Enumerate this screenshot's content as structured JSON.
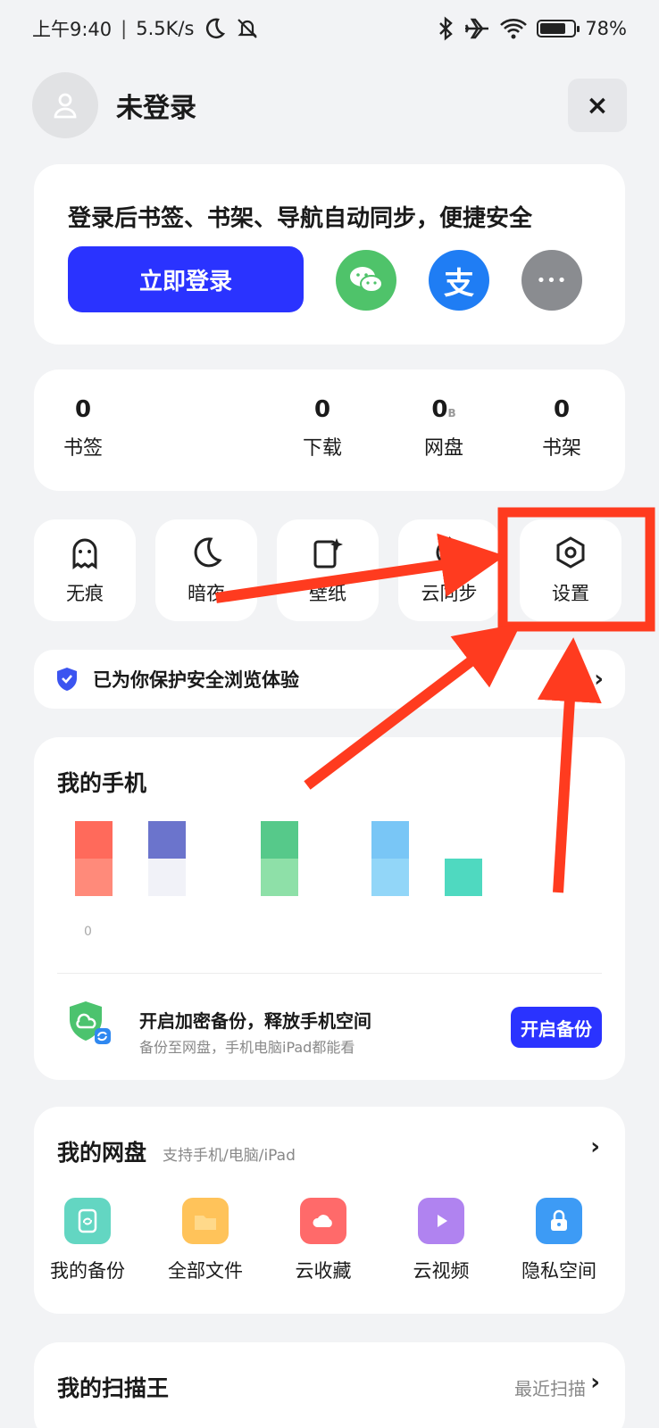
{
  "status_bar": {
    "time": "上午9:40",
    "net_speed": "5.5K/s",
    "battery": "78%",
    "battery_level": 0.78,
    "icons": [
      "moon-icon",
      "mute-icon",
      "bluetooth-icon",
      "airplane-icon",
      "wifi-icon",
      "battery-icon"
    ]
  },
  "header": {
    "user_name": "未登录",
    "close_label": "×"
  },
  "login": {
    "hint": "登录后书签、书架、导航自动同步，便捷安全",
    "button": "立即登录",
    "providers": [
      "wechat-icon",
      "alipay-icon",
      "more-icon"
    ],
    "more_glyph": "•••",
    "alipay_glyph": "支"
  },
  "stats": [
    {
      "value": "0",
      "unit": "",
      "label": "书签"
    },
    {
      "value": "0",
      "unit": "",
      "label": "下载"
    },
    {
      "value": "0",
      "unit": "B",
      "label": "网盘"
    },
    {
      "value": "0",
      "unit": "",
      "label": "书架"
    }
  ],
  "quick_tiles": [
    {
      "label": "无痕",
      "icon": "ghost-icon"
    },
    {
      "label": "暗夜",
      "icon": "moon-icon"
    },
    {
      "label": "壁纸",
      "icon": "wallpaper-icon"
    },
    {
      "label": "云同步",
      "icon": "sync-icon"
    },
    {
      "label": "设置",
      "icon": "gear-icon"
    }
  ],
  "security": {
    "text": "已为你保护安全浏览体验",
    "chevron": "›"
  },
  "my_phone": {
    "title": "我的手机",
    "zero_label": "0",
    "backup_title": "开启加密备份，释放手机空间",
    "backup_sub": "备份至网盘，手机电脑iPad都能看",
    "backup_button": "开启备份",
    "colors": [
      "#ff6a5b",
      "#6b74cc",
      "#56c98a",
      "#79c6f6",
      "#4fd9c0"
    ]
  },
  "my_disk": {
    "title": "我的网盘",
    "subtitle": "支持手机/电脑/iPad",
    "chevron": "›",
    "items": [
      {
        "label": "我的备份",
        "icon": "backup-icon",
        "color": "#63d6c2"
      },
      {
        "label": "全部文件",
        "icon": "folder-icon",
        "color": "#ffc35a"
      },
      {
        "label": "云收藏",
        "icon": "cloud-favorite-icon",
        "color": "#ff6a6a"
      },
      {
        "label": "云视频",
        "icon": "cloud-video-icon",
        "color": "#b083f0"
      },
      {
        "label": "隐私空间",
        "icon": "lock-icon",
        "color": "#3d9bf5"
      }
    ]
  },
  "scan": {
    "title": "我的扫描王",
    "right_text": "最近扫描",
    "chevron": "›"
  },
  "colors": {
    "accent": "#2a33ff",
    "annotation": "#ff3b1f"
  }
}
